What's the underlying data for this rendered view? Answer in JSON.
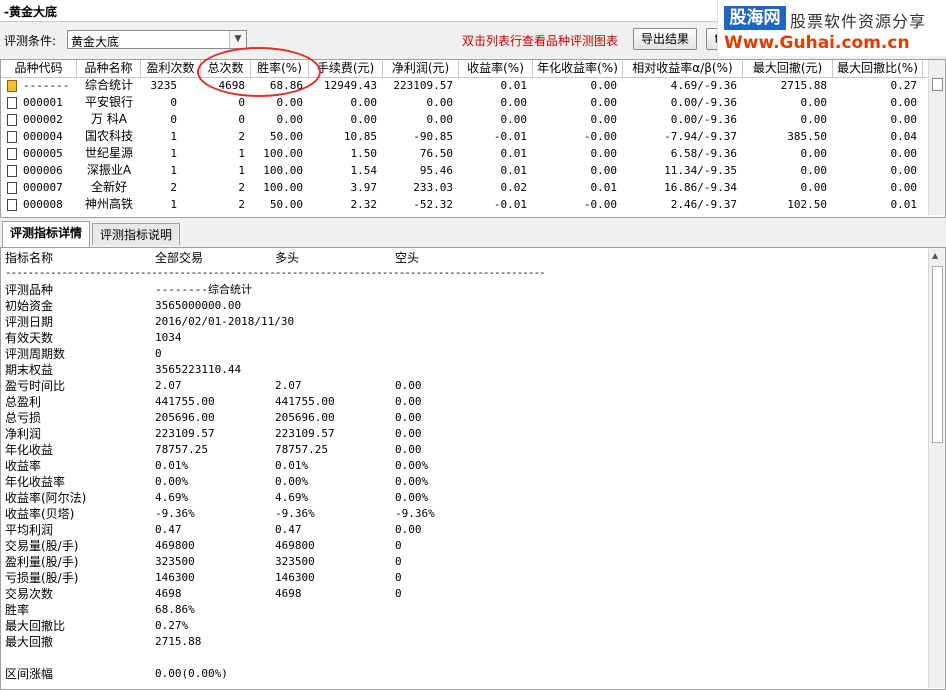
{
  "window": {
    "title": "-黄金大底"
  },
  "toolbar": {
    "condition_label": "评测条件:",
    "condition_value": "黄金大底",
    "hint": "双击列表行查看品种评测图表",
    "export_label": "导出结果",
    "extra_label": "t"
  },
  "watermark": {
    "logo": "股海网",
    "slogan": "股票软件资源分享",
    "url": "Www.Guhai.com.cn"
  },
  "table": {
    "headers": [
      "品种代码",
      "品种名称",
      "盈利次数",
      "总次数",
      "胜率(%)",
      "手续费(元)",
      "净利润(元)",
      "收益率(%)",
      "年化收益率(%)",
      "相对收益率α/β(%)",
      "最大回撤(元)",
      "最大回撤比(%)"
    ],
    "rows": [
      [
        "-------",
        "综合统计",
        "3235",
        "4698",
        "68.86",
        "12949.43",
        "223109.57",
        "0.01",
        "0.00",
        "4.69/-9.36",
        "2715.88",
        "0.27"
      ],
      [
        "000001",
        "平安银行",
        "0",
        "0",
        "0.00",
        "0.00",
        "0.00",
        "0.00",
        "0.00",
        "0.00/-9.36",
        "0.00",
        "0.00"
      ],
      [
        "000002",
        "万 科A",
        "0",
        "0",
        "0.00",
        "0.00",
        "0.00",
        "0.00",
        "0.00",
        "0.00/-9.36",
        "0.00",
        "0.00"
      ],
      [
        "000004",
        "国农科技",
        "1",
        "2",
        "50.00",
        "10.85",
        "-90.85",
        "-0.01",
        "-0.00",
        "-7.94/-9.37",
        "385.50",
        "0.04"
      ],
      [
        "000005",
        "世纪星源",
        "1",
        "1",
        "100.00",
        "1.50",
        "76.50",
        "0.01",
        "0.00",
        "6.58/-9.36",
        "0.00",
        "0.00"
      ],
      [
        "000006",
        "深振业A",
        "1",
        "1",
        "100.00",
        "1.54",
        "95.46",
        "0.01",
        "0.00",
        "11.34/-9.35",
        "0.00",
        "0.00"
      ],
      [
        "000007",
        "全新好",
        "2",
        "2",
        "100.00",
        "3.97",
        "233.03",
        "0.02",
        "0.01",
        "16.86/-9.34",
        "0.00",
        "0.00"
      ],
      [
        "000008",
        "神州高铁",
        "1",
        "2",
        "50.00",
        "2.32",
        "-52.32",
        "-0.01",
        "-0.00",
        "2.46/-9.37",
        "102.50",
        "0.01"
      ]
    ]
  },
  "tabs": [
    "评测指标详情",
    "评测指标说明"
  ],
  "detail": {
    "header": [
      "指标名称",
      "全部交易",
      "多头",
      "空头"
    ],
    "dashes": "------------------------------------------------------------------------------------------------",
    "lines": [
      [
        "评测品种",
        "--------综合统计",
        "",
        ""
      ],
      [
        "初始资金",
        "3565000000.00",
        "",
        ""
      ],
      [
        "评测日期",
        "2016/02/01-2018/11/30",
        "",
        ""
      ],
      [
        "有效天数",
        "1034",
        "",
        ""
      ],
      [
        "评测周期数",
        "0",
        "",
        ""
      ],
      [
        "期末权益",
        "3565223110.44",
        "",
        ""
      ],
      [
        "盈亏时间比",
        "2.07",
        "2.07",
        "0.00"
      ],
      [
        "总盈利",
        "441755.00",
        "441755.00",
        "0.00"
      ],
      [
        "总亏损",
        "205696.00",
        "205696.00",
        "0.00"
      ],
      [
        "净利润",
        "223109.57",
        "223109.57",
        "0.00"
      ],
      [
        "年化收益",
        "78757.25",
        "78757.25",
        "0.00"
      ],
      [
        "收益率",
        "0.01%",
        "0.01%",
        "0.00%"
      ],
      [
        "年化收益率",
        "0.00%",
        "0.00%",
        "0.00%"
      ],
      [
        "收益率(阿尔法)",
        "4.69%",
        "4.69%",
        "0.00%"
      ],
      [
        "收益率(贝塔)",
        "-9.36%",
        "-9.36%",
        "-9.36%"
      ],
      [
        "平均利润",
        "0.47",
        "0.47",
        "0.00"
      ],
      [
        "交易量(股/手)",
        "469800",
        "469800",
        "0"
      ],
      [
        "盈利量(股/手)",
        "323500",
        "323500",
        "0"
      ],
      [
        "亏损量(股/手)",
        "146300",
        "146300",
        "0"
      ],
      [
        "交易次数",
        "4698",
        "4698",
        "0"
      ],
      [
        "胜率",
        "68.86%",
        "",
        ""
      ],
      [
        "最大回撤比",
        "0.27%",
        "",
        ""
      ],
      [
        "最大回撤",
        "2715.88",
        "",
        ""
      ],
      [
        "",
        "",
        "",
        ""
      ],
      [
        "区间涨幅",
        "0.00(0.00%)",
        "",
        ""
      ]
    ]
  },
  "colors": {
    "annotation_circle": "#e0302a",
    "hint": "#c00000",
    "url": "#e53a00",
    "logo_bg": "#1d66c7"
  }
}
